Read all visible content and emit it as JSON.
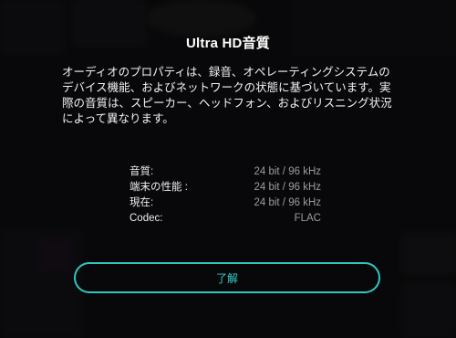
{
  "dialog": {
    "title": "Ultra HD音質",
    "description": "オーディオのプロパティは、録音、オペレーティングシステムのデバイス機能、およびネットワークの状態に基づいています。実際の音質は、スピーカー、ヘッドフォン、およびリスニング状況によって異なります。",
    "info": [
      {
        "label": "音質:",
        "value": "24 bit / 96 kHz"
      },
      {
        "label": "端末の性能 :",
        "value": "24 bit / 96 kHz"
      },
      {
        "label": "現在:",
        "value": "24 bit / 96 kHz"
      },
      {
        "label": "Codec:",
        "value": "FLAC"
      }
    ],
    "ok_label": "了解"
  },
  "colors": {
    "accent": "#2ec8c1",
    "background": "#0d0d0e",
    "value_text": "#9c9c9c"
  }
}
